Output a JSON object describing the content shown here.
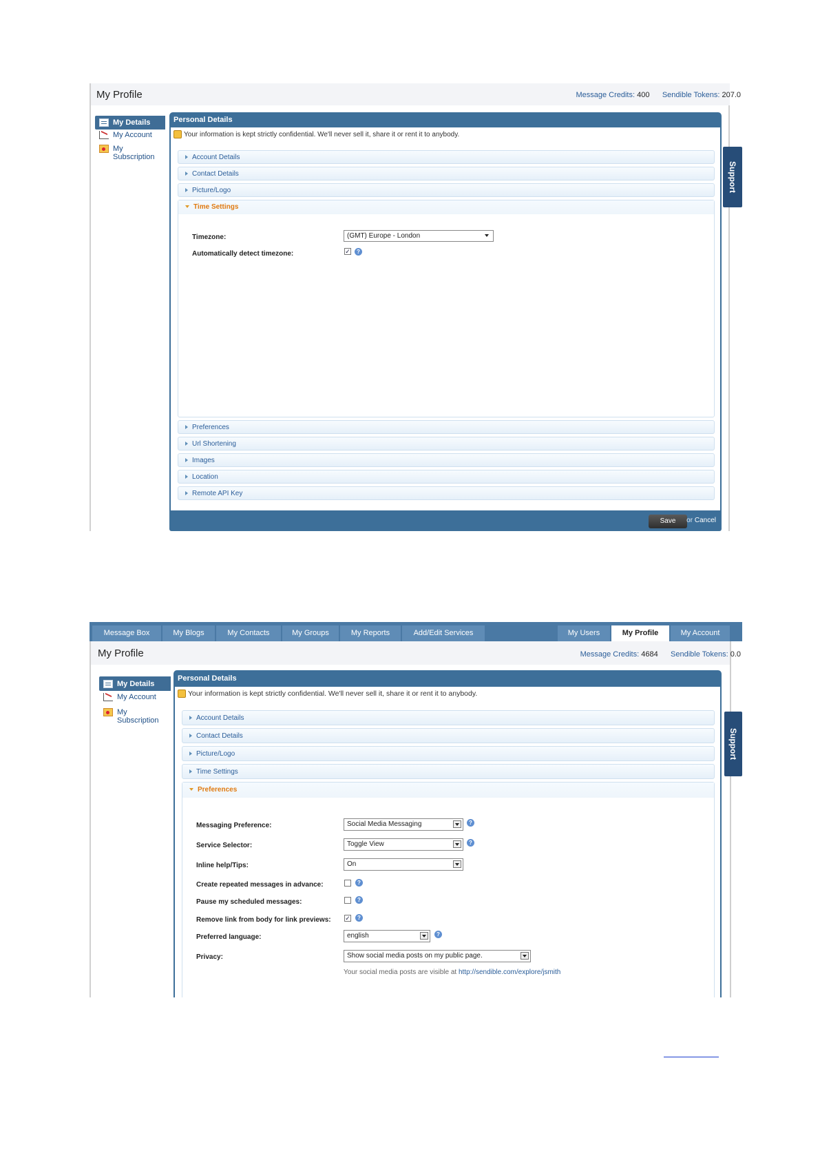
{
  "screenshot1": {
    "page_title": "My Profile",
    "message_credits_label": "Message Credits:",
    "message_credits_value": "400",
    "sendible_tokens_label": "Sendible Tokens:",
    "sendible_tokens_value": "207.0",
    "sidebar": [
      {
        "label": "My Details",
        "icon": "id-card-icon",
        "active": true
      },
      {
        "label": "My Account",
        "icon": "chart-icon",
        "active": false
      },
      {
        "label": "My Subscription",
        "icon": "subscription-icon",
        "active": false
      }
    ],
    "panel_title": "Personal Details",
    "notice": "Your information is kept strictly confidential. We'll never sell it, share it or rent it to anybody.",
    "sections_before": [
      "Account Details",
      "Contact Details",
      "Picture/Logo"
    ],
    "open_section": "Time Settings",
    "fields": {
      "timezone_label": "Timezone:",
      "timezone_value": "(GMT) Europe - London",
      "auto_detect_label": "Automatically detect timezone:",
      "auto_detect_checked": true
    },
    "sections_after": [
      "Preferences",
      "Url Shortening",
      "Images",
      "Location",
      "Remote API Key"
    ],
    "save_label": "Save",
    "or_label": "or",
    "cancel_label": "Cancel",
    "support_label": "Support"
  },
  "screenshot2": {
    "nav_tabs_left": [
      "Message Box",
      "My Blogs",
      "My Contacts",
      "My Groups",
      "My Reports",
      "Add/Edit Services"
    ],
    "nav_tabs_right": [
      "My Users",
      "My Profile",
      "My Account"
    ],
    "active_tab": "My Profile",
    "page_title": "My Profile",
    "message_credits_label": "Message Credits:",
    "message_credits_value": "4684",
    "sendible_tokens_label": "Sendible Tokens:",
    "sendible_tokens_value": "0.0",
    "sidebar": [
      {
        "label": "My Details",
        "icon": "id-card-icon",
        "active": true
      },
      {
        "label": "My Account",
        "icon": "chart-icon",
        "active": false
      },
      {
        "label": "My Subscription",
        "line1": "My",
        "line2": "Subscription",
        "icon": "subscription-icon",
        "active": false
      }
    ],
    "panel_title": "Personal Details",
    "notice": "Your information is kept strictly confidential. We'll never sell it, share it or rent it to anybody.",
    "sections_before": [
      "Account Details",
      "Contact Details",
      "Picture/Logo",
      "Time Settings"
    ],
    "open_section": "Preferences",
    "fields": {
      "messaging_pref_label": "Messaging Preference:",
      "messaging_pref_value": "Social Media Messaging",
      "service_selector_label": "Service Selector:",
      "service_selector_value": "Toggle View",
      "inline_help_label": "Inline help/Tips:",
      "inline_help_value": "On",
      "repeated_label": "Create repeated messages in advance:",
      "repeated_checked": false,
      "pause_label": "Pause my scheduled messages:",
      "pause_checked": false,
      "remove_link_label": "Remove link from body for link previews:",
      "remove_link_checked": true,
      "language_label": "Preferred language:",
      "language_value": "english",
      "privacy_label": "Privacy:",
      "privacy_value": "Show social media posts on my public page.",
      "privacy_hint": "Your social media posts are visible at",
      "privacy_url": "http://sendible.com/explore/jsmith"
    },
    "support_label": "Support"
  }
}
